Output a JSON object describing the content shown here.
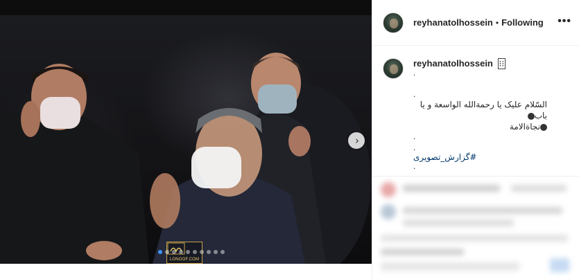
{
  "post": {
    "username": "reyhanatolhossein",
    "follow_separator": "•",
    "follow_status": "Following",
    "more_label": "•••"
  },
  "caption": {
    "username": "reyhanatolhossein",
    "username_glyph": "⁝⁝",
    "lines_before": [
      "."
    ],
    "dot_line": ".",
    "arabic_text_1": "السّلام علیک یا رحمةالله الواسعة و یا باب",
    "arabic_text_2": "نجاةالامة",
    "lines_after": [
      ".",
      "."
    ],
    "hashtag": "#گزارش_تصویری",
    "final_dot": "."
  },
  "media": {
    "watermark_text": "LONOOF.COM",
    "carousel_count": 10,
    "carousel_active_index": 0,
    "next_icon": "chevron-right-icon"
  },
  "colors": {
    "accent": "#3d95f5",
    "hashtag": "#00376b",
    "watermark_gold": "#c7a24a"
  }
}
